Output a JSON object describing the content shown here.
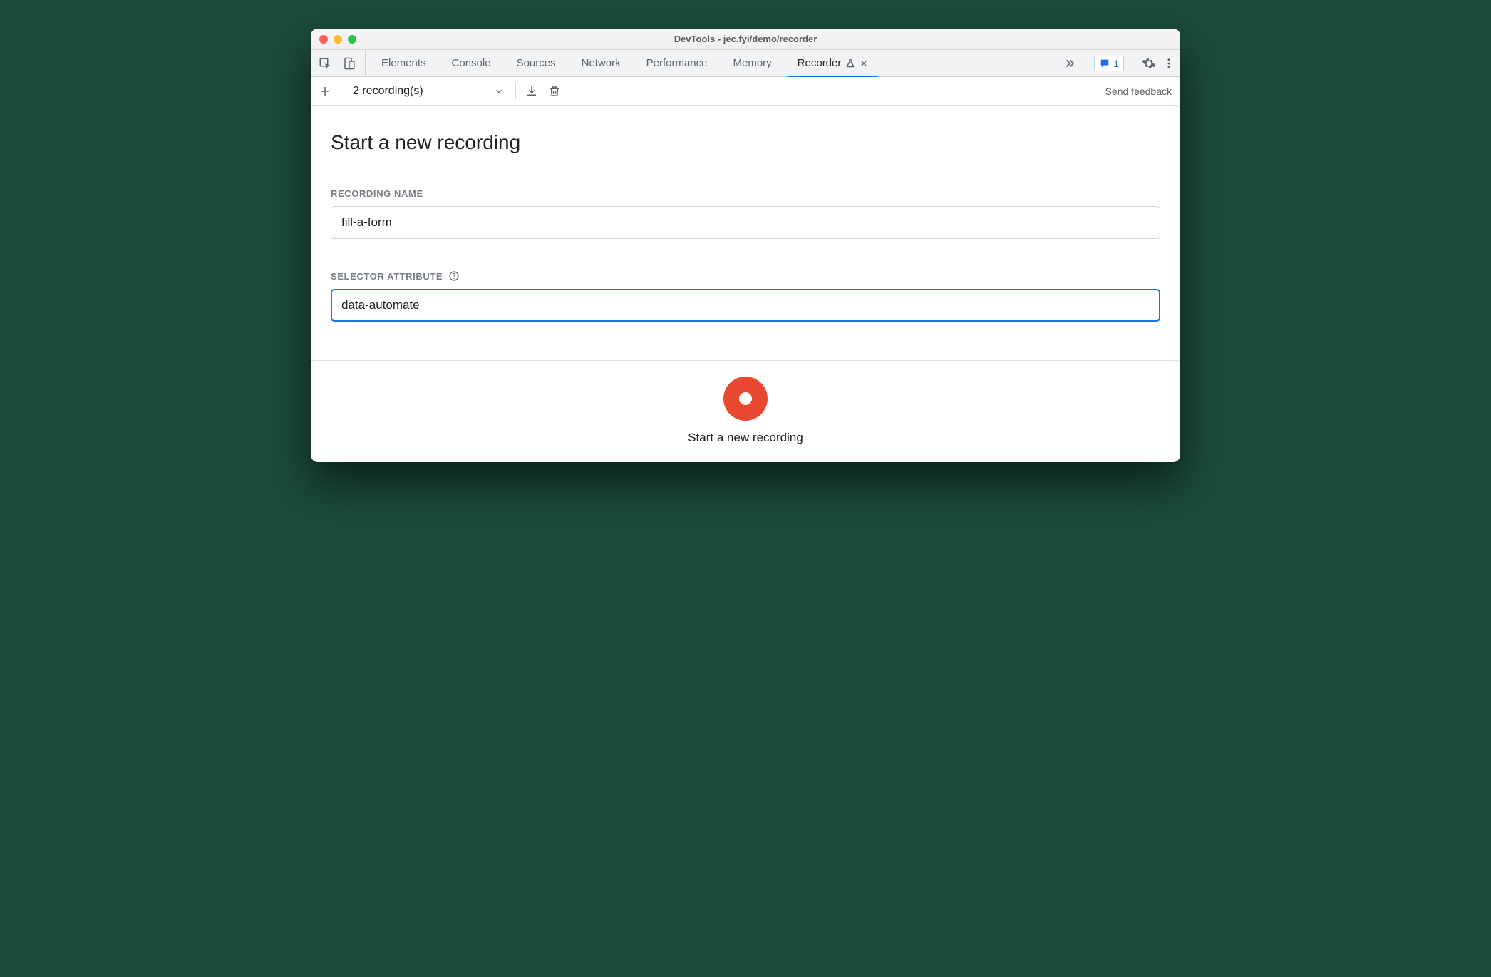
{
  "window": {
    "title": "DevTools - jec.fyi/demo/recorder"
  },
  "tabs": {
    "items": [
      {
        "label": "Elements"
      },
      {
        "label": "Console"
      },
      {
        "label": "Sources"
      },
      {
        "label": "Network"
      },
      {
        "label": "Performance"
      },
      {
        "label": "Memory"
      },
      {
        "label": "Recorder",
        "active": true,
        "experimental": true,
        "closable": true
      }
    ],
    "issues_count": "1"
  },
  "toolbar": {
    "recordings_label": "2 recording(s)",
    "feedback_label": "Send feedback"
  },
  "main": {
    "heading": "Start a new recording",
    "recording_name_label": "RECORDING NAME",
    "recording_name_value": "fill-a-form",
    "selector_attr_label": "SELECTOR ATTRIBUTE",
    "selector_attr_value": "data-automate"
  },
  "footer": {
    "start_label": "Start a new recording"
  }
}
